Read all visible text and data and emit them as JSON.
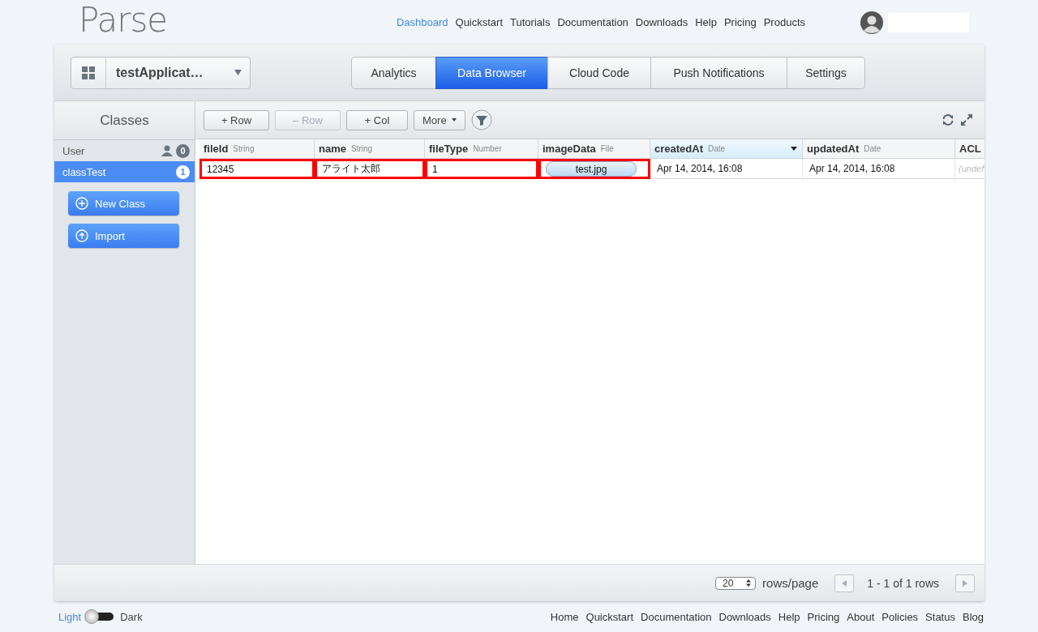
{
  "header": {
    "logo": "Parse",
    "nav": [
      {
        "label": "Dashboard",
        "selected": true
      },
      {
        "label": "Quickstart",
        "selected": false
      },
      {
        "label": "Tutorials",
        "selected": false
      },
      {
        "label": "Documentation",
        "selected": false
      },
      {
        "label": "Downloads",
        "selected": false
      },
      {
        "label": "Help",
        "selected": false
      },
      {
        "label": "Pricing",
        "selected": false
      },
      {
        "label": "Products",
        "selected": false
      }
    ]
  },
  "app_selector": {
    "name": "testApplicat…"
  },
  "tabs": [
    {
      "label": "Analytics",
      "selected": false
    },
    {
      "label": "Data Browser",
      "selected": true
    },
    {
      "label": "Cloud Code",
      "selected": false
    },
    {
      "label": "Push Notifications",
      "selected": false
    },
    {
      "label": "Settings",
      "selected": false
    }
  ],
  "sidebar": {
    "title": "Classes",
    "classes": [
      {
        "name": "User",
        "count": "0",
        "kind": "user",
        "selected": false
      },
      {
        "name": "classTest",
        "count": "1",
        "kind": "custom",
        "selected": true
      }
    ],
    "buttons": [
      {
        "label": "New Class",
        "kind": "plus"
      },
      {
        "label": "Import",
        "kind": "upload"
      }
    ]
  },
  "toolbar": {
    "buttons": [
      {
        "label": "+ Row",
        "disabled": false
      },
      {
        "label": "– Row",
        "disabled": true
      },
      {
        "label": "+ Col",
        "disabled": false
      },
      {
        "label": "More",
        "disabled": false
      }
    ]
  },
  "table": {
    "columns": [
      {
        "name": "fileId",
        "type": "String",
        "sorted": false
      },
      {
        "name": "name",
        "type": "String",
        "sorted": false
      },
      {
        "name": "fileType",
        "type": "Number",
        "sorted": false
      },
      {
        "name": "imageData",
        "type": "File",
        "sorted": false
      },
      {
        "name": "createdAt",
        "type": "Date",
        "sorted": true
      },
      {
        "name": "updatedAt",
        "type": "Date",
        "sorted": false
      },
      {
        "name": "ACL",
        "sorted": false
      }
    ],
    "rows": [
      [
        {
          "value": "12345",
          "kind": "text",
          "highlighted": true
        },
        {
          "value": "アライト太郎",
          "kind": "text",
          "highlighted": true
        },
        {
          "value": "1",
          "kind": "text",
          "highlighted": true
        },
        {
          "value": "test.jpg",
          "kind": "file",
          "highlighted": true
        },
        {
          "value": "Apr 14, 2014, 16:08",
          "kind": "text",
          "highlighted": false
        },
        {
          "value": "Apr 14, 2014, 16:08",
          "kind": "text",
          "highlighted": false
        },
        {
          "value": "(undef",
          "kind": "undefined",
          "highlighted": false
        }
      ]
    ]
  },
  "pagination": {
    "page_size": "20",
    "page_size_label": "rows/page",
    "range": "1 - 1 of 1 rows"
  },
  "theme": {
    "options": [
      {
        "label": "Light",
        "selected": true
      },
      {
        "label": "Dark",
        "selected": false
      }
    ]
  },
  "footer": {
    "links": [
      "Home",
      "Quickstart",
      "Documentation",
      "Downloads",
      "Help",
      "Pricing",
      "About",
      "Policies",
      "Status",
      "Blog"
    ]
  }
}
